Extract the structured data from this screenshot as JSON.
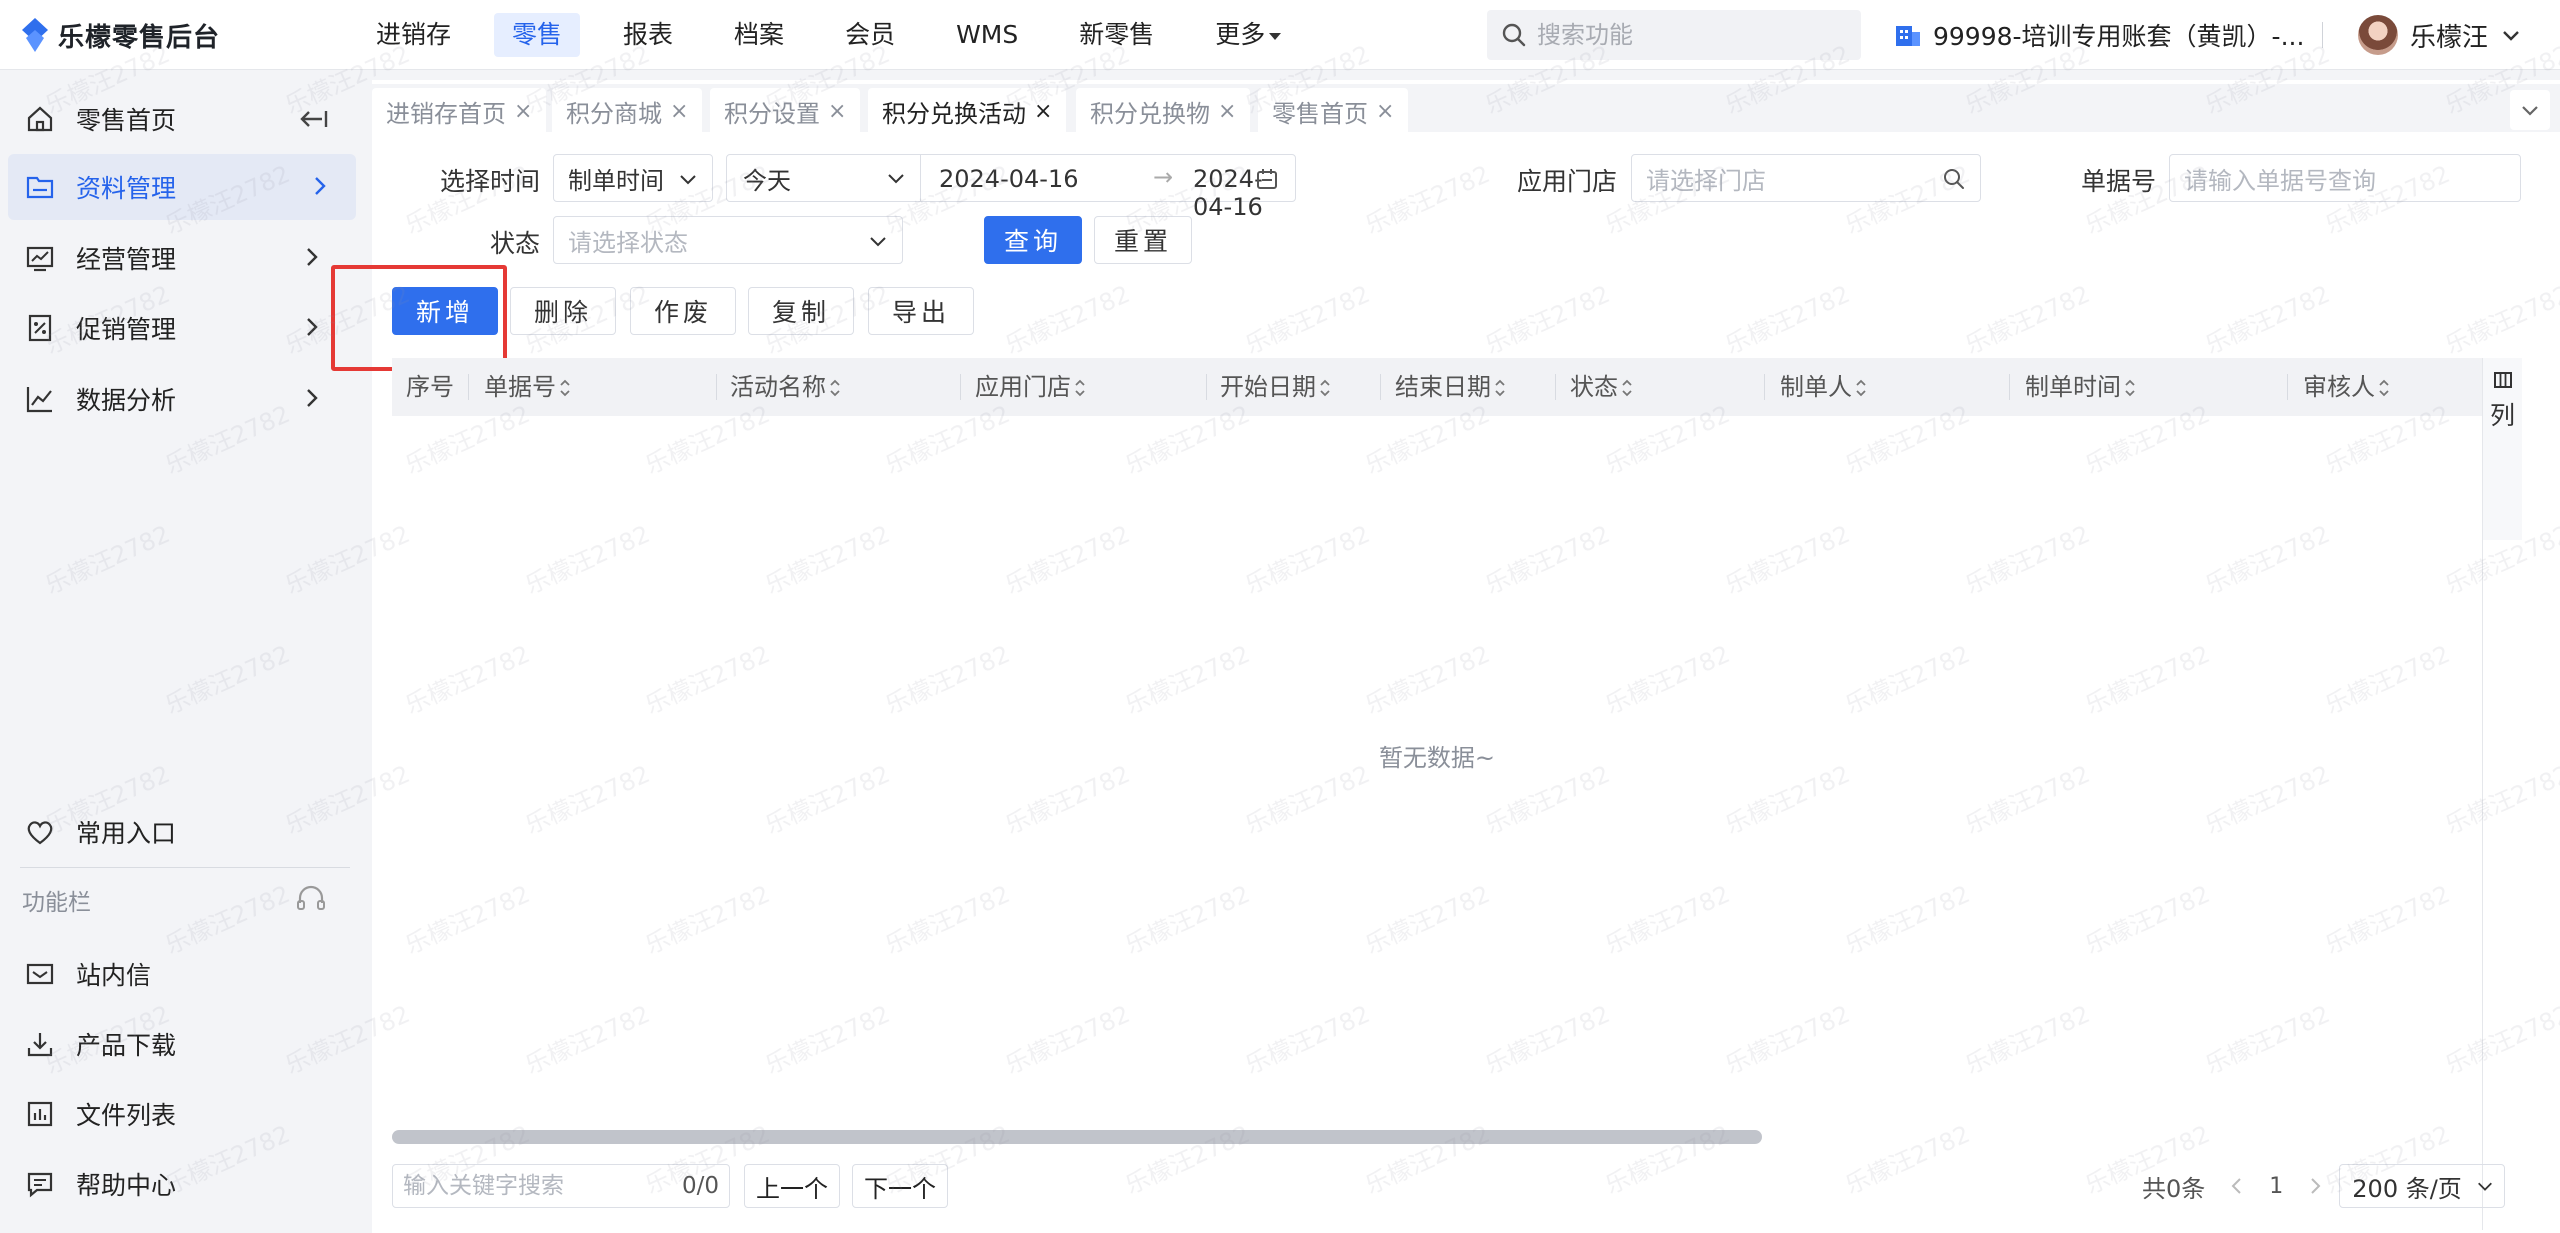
{
  "app": {
    "name": "乐檬零售后台"
  },
  "topnav": {
    "items": [
      "进销存",
      "零售",
      "报表",
      "档案",
      "会员",
      "WMS",
      "新零售",
      "更多"
    ],
    "active_index": 1
  },
  "search": {
    "placeholder": "搜索功能"
  },
  "account": {
    "label": "99998-培训专用账套（黄凯）-..."
  },
  "user": {
    "name": "乐檬汪"
  },
  "sidebar": {
    "items": [
      {
        "label": "零售首页",
        "icon": "home-icon"
      },
      {
        "label": "资料管理",
        "icon": "folder-icon",
        "active": true
      },
      {
        "label": "经营管理",
        "icon": "monitor-chart-icon"
      },
      {
        "label": "促销管理",
        "icon": "promo-tag-icon"
      },
      {
        "label": "数据分析",
        "icon": "line-chart-icon"
      }
    ],
    "favorites": "常用入口",
    "section_title": "功能栏",
    "tools": [
      {
        "label": "站内信",
        "icon": "mail-icon"
      },
      {
        "label": "产品下载",
        "icon": "download-icon"
      },
      {
        "label": "文件列表",
        "icon": "file-list-icon"
      },
      {
        "label": "帮助中心",
        "icon": "help-chat-icon"
      }
    ]
  },
  "tabs": [
    {
      "label": "进销存首页"
    },
    {
      "label": "积分商城"
    },
    {
      "label": "积分设置"
    },
    {
      "label": "积分兑换活动",
      "active": true
    },
    {
      "label": "积分兑换物"
    },
    {
      "label": "零售首页"
    }
  ],
  "filters": {
    "time_label": "选择时间",
    "time_type": "制单时间",
    "time_range": "今天",
    "date_start": "2024-04-16",
    "date_end": "2024-04-16",
    "store_label": "应用门店",
    "store_placeholder": "请选择门店",
    "bill_label": "单据号",
    "bill_placeholder": "请输入单据号查询",
    "status_label": "状态",
    "status_placeholder": "请选择状态",
    "query": "查询",
    "reset": "重置"
  },
  "actions": {
    "add": "新增",
    "delete": "删除",
    "void": "作废",
    "copy": "复制",
    "export": "导出"
  },
  "table": {
    "columns": [
      "序号",
      "单据号",
      "活动名称",
      "应用门店",
      "开始日期",
      "结束日期",
      "状态",
      "制单人",
      "制单时间",
      "审核人"
    ],
    "column_settings": "列",
    "empty_text": "暂无数据~"
  },
  "footer": {
    "search_placeholder": "输入关键字搜索",
    "match_count": "0/0",
    "prev": "上一个",
    "next": "下一个",
    "total": "共0条",
    "page": "1",
    "page_size": "200 条/页"
  },
  "watermark": "乐檬汪2782",
  "colors": {
    "primary": "#2f6fed",
    "highlight": "#e53935",
    "active_nav_bg": "#e6eeff"
  }
}
